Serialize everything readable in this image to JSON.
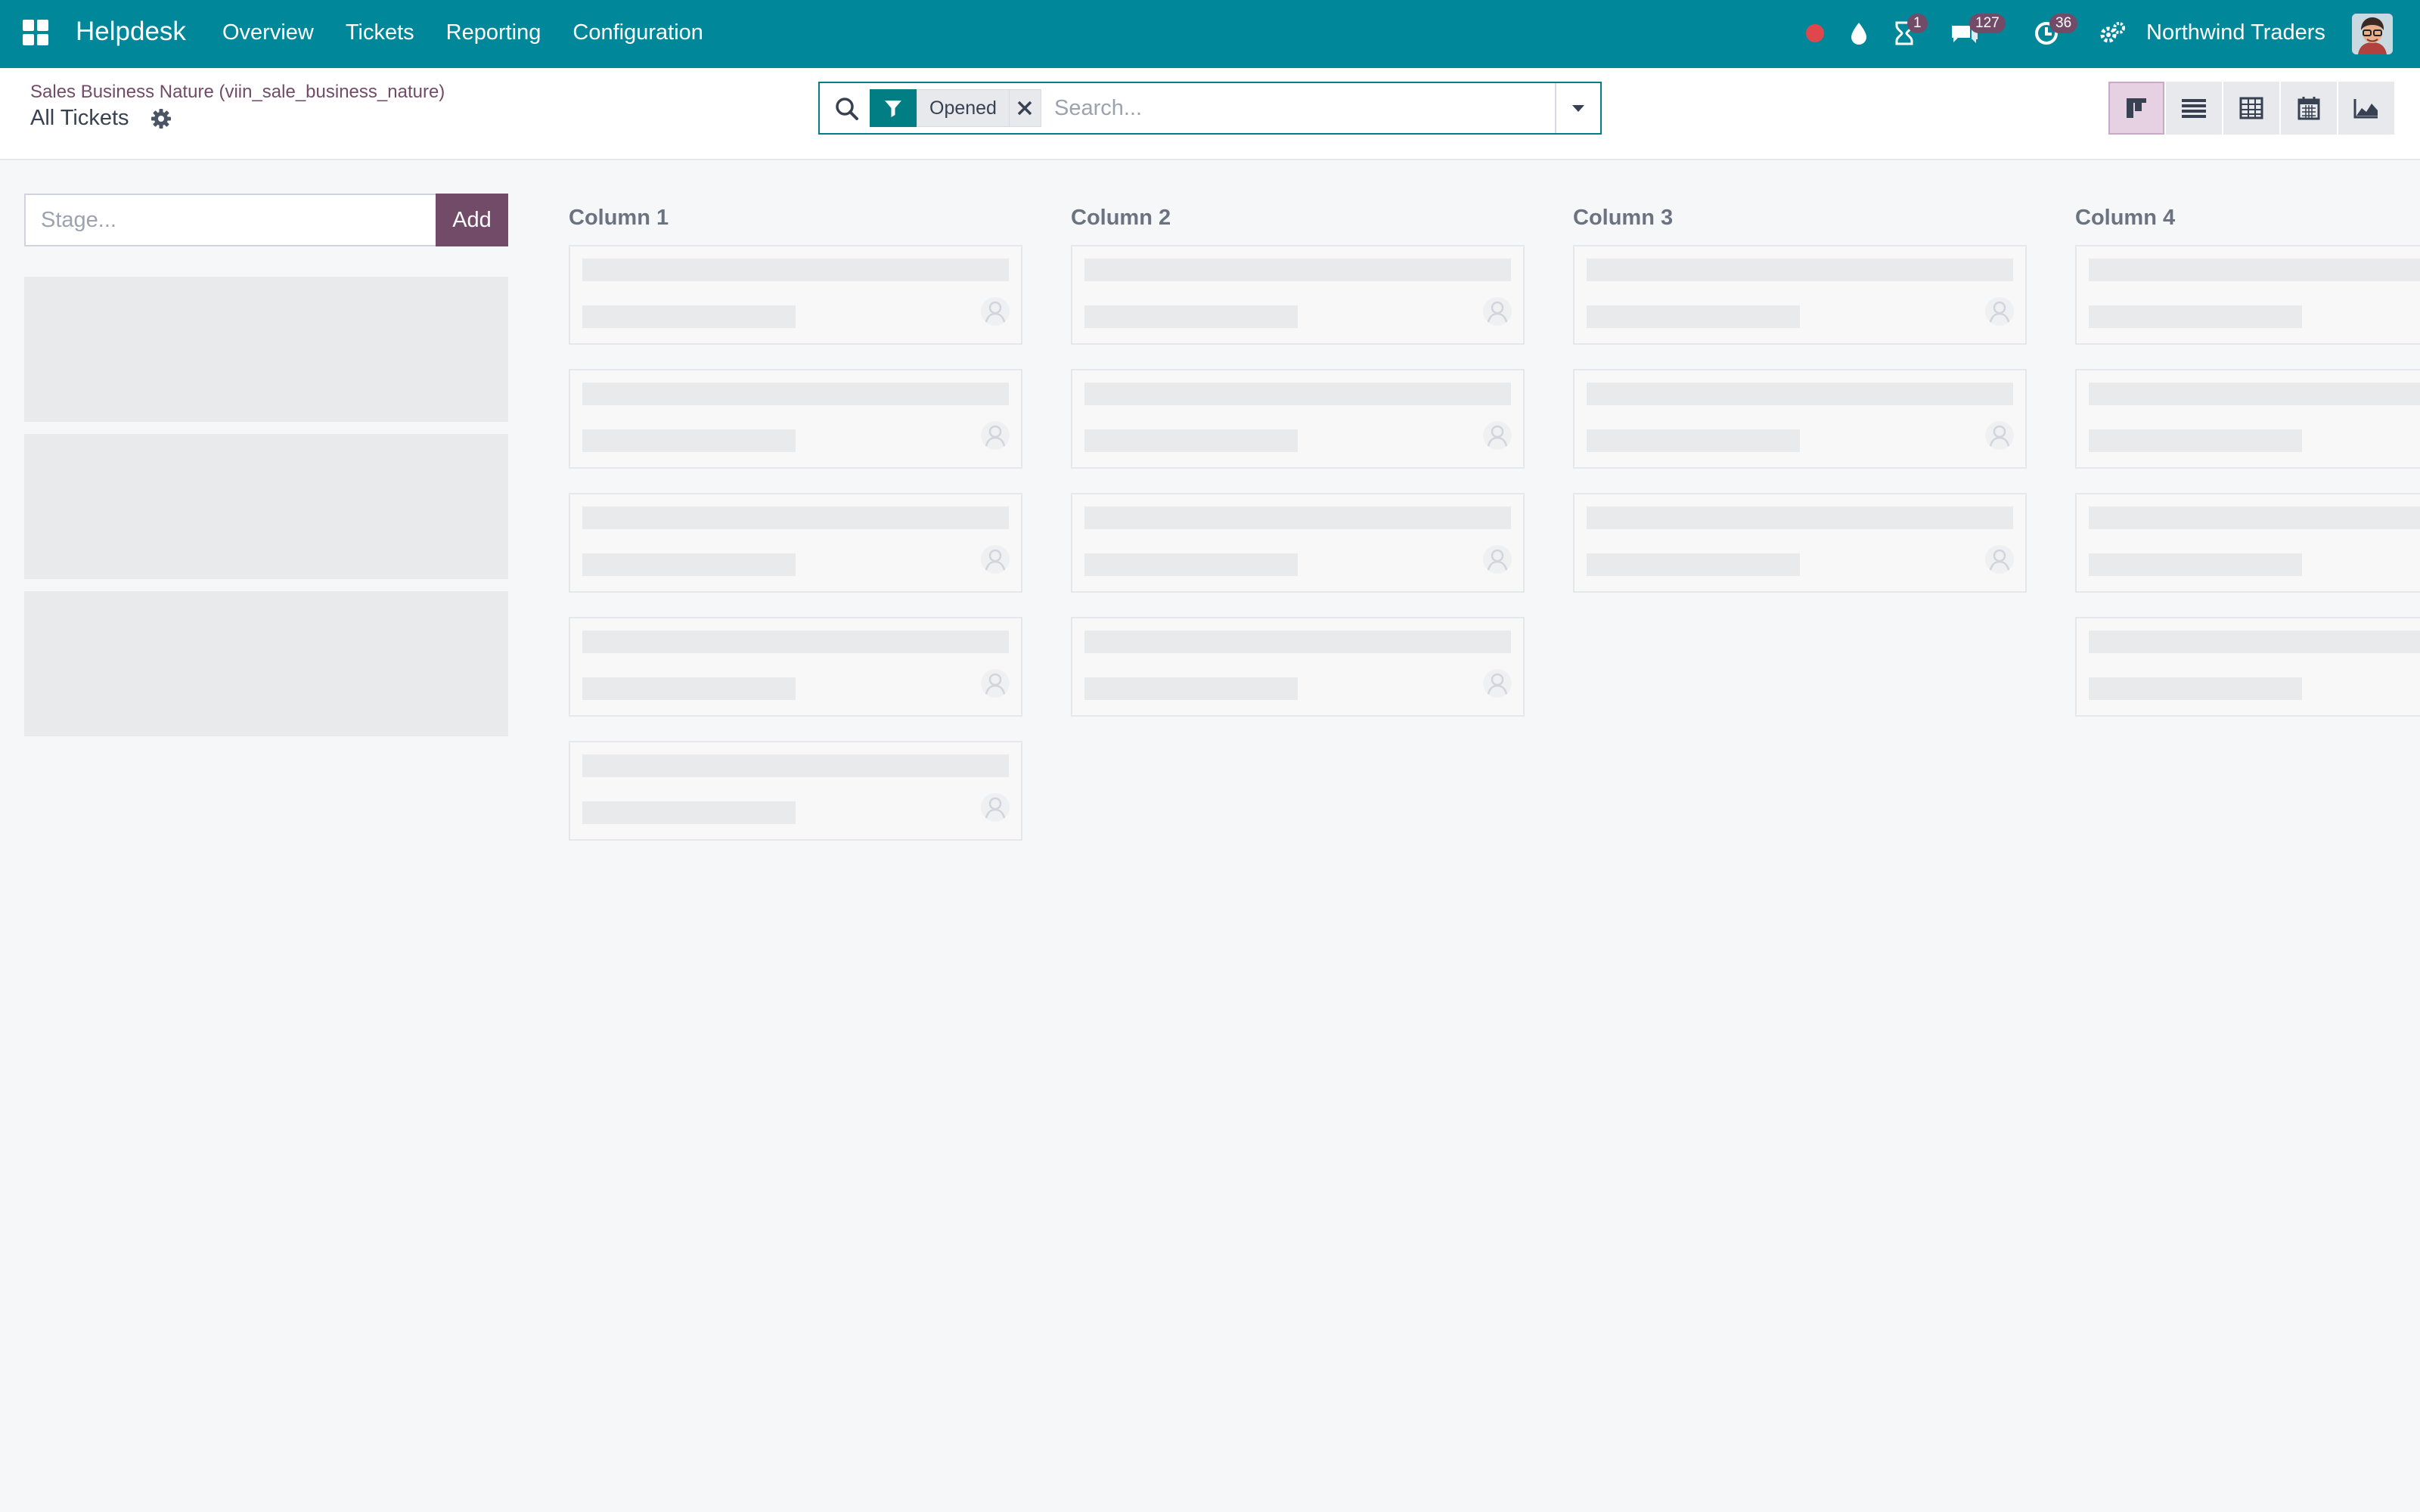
{
  "navbar": {
    "brand": "Helpdesk",
    "menu": [
      "Overview",
      "Tickets",
      "Reporting",
      "Configuration"
    ],
    "badges": {
      "activity": "1",
      "messages": "127",
      "timer": "36"
    },
    "company": "Northwind Traders",
    "icons": [
      "apps-icon",
      "record-icon",
      "drop-icon",
      "hourglass-icon",
      "chat-icon",
      "clock-icon",
      "settings-icon"
    ]
  },
  "control_panel": {
    "breadcrumb": "Sales Business Nature (viin_sale_business_nature)",
    "title": "All Tickets",
    "search": {
      "facet": "Opened",
      "placeholder": "Search..."
    },
    "views": [
      "kanban",
      "list",
      "pivot",
      "calendar",
      "graph"
    ],
    "active_view": "kanban"
  },
  "stage_form": {
    "placeholder": "Stage...",
    "add_label": "Add"
  },
  "columns": [
    {
      "title": "Column 1",
      "cards": 5
    },
    {
      "title": "Column 2",
      "cards": 4
    },
    {
      "title": "Column 3",
      "cards": 3
    },
    {
      "title": "Column 4",
      "cards": 4
    }
  ],
  "colors": {
    "navbar": "#00889a",
    "brand_purple": "#714b67",
    "facet_teal": "#017e84",
    "record_red": "#e0474c"
  }
}
